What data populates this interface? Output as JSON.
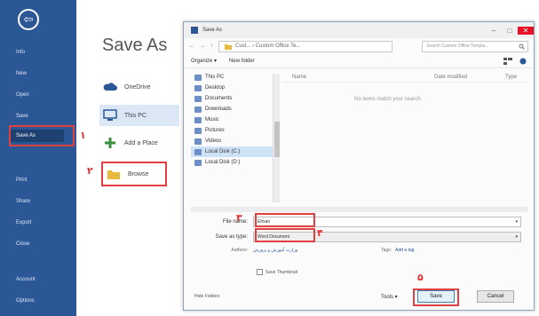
{
  "sidebar": {
    "back_glyph": "⇦",
    "items": [
      {
        "label": "Info"
      },
      {
        "label": "New"
      },
      {
        "label": "Open"
      },
      {
        "label": "Save"
      },
      {
        "label": "Save As"
      },
      {
        "label": "Print"
      },
      {
        "label": "Share"
      },
      {
        "label": "Export"
      },
      {
        "label": "Close"
      },
      {
        "label": "Account"
      },
      {
        "label": "Options"
      }
    ],
    "bg_color": "#2b5797"
  },
  "page_title": "Save As",
  "places": [
    {
      "label": "OneDrive",
      "icon": "cloud-icon"
    },
    {
      "label": "This PC",
      "icon": "computer-icon"
    },
    {
      "label": "Add a Place",
      "icon": "plus-icon"
    },
    {
      "label": "Browse",
      "icon": "folder-icon"
    }
  ],
  "markers": {
    "m1": "۱",
    "m2": "۲",
    "m3": "۳",
    "m4": "۴",
    "m5": "۵"
  },
  "dialog": {
    "title": "Save As",
    "win_buttons": {
      "minimize": "–",
      "maximize": "□",
      "close": "✕"
    },
    "nav_back": "←",
    "nav_forward": "→",
    "nav_up": "↑",
    "address": "Cust... › Custom Office Te...",
    "search_placeholder": "Search Custom Office Templa...",
    "organize": "Organize ▾",
    "new_folder": "New folder",
    "nav_items": [
      {
        "label": "This PC"
      },
      {
        "label": "Desktop"
      },
      {
        "label": "Documents"
      },
      {
        "label": "Downloads"
      },
      {
        "label": "Music"
      },
      {
        "label": "Pictures"
      },
      {
        "label": "Videos"
      },
      {
        "label": "Local Disk (C:)"
      },
      {
        "label": "Local Disk (D:)"
      }
    ],
    "columns": {
      "name": "Name",
      "date": "Date modified",
      "type": "Type"
    },
    "empty_message": "No items match your search.",
    "file_name_label": "File name:",
    "file_name_value": "Ehsan",
    "save_type_label": "Save as type:",
    "save_type_value": "Word Document",
    "authors_label": "Authors:",
    "authors_value": "وزارت آموزش و پرورش",
    "tags_label": "Tags:",
    "tags_value": "Add a tag",
    "thumbnail_label": "Save Thumbnail",
    "hide_folders": "Hide Folders",
    "tools": "Tools ▾",
    "save_button": "Save",
    "cancel_button": "Cancel"
  },
  "colors": {
    "accent": "#2b5797",
    "marker_red": "#e53232"
  }
}
